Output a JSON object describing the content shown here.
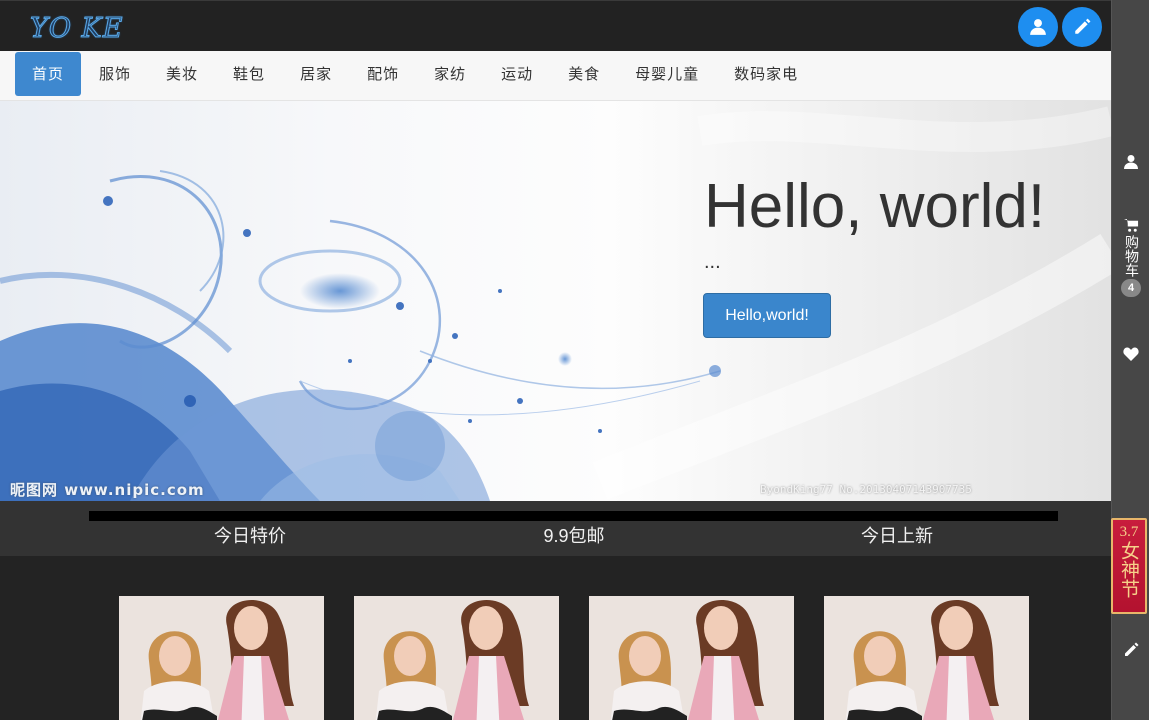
{
  "brand": {
    "logo_text": "YO KE"
  },
  "header": {
    "user_icon": "user-icon",
    "edit_icon": "pencil-icon"
  },
  "nav": {
    "items": [
      "首页",
      "服饰",
      "美妆",
      "鞋包",
      "居家",
      "配饰",
      "家纺",
      "运动",
      "美食",
      "母婴儿童",
      "数码家电"
    ],
    "active_index": 0
  },
  "hero": {
    "title": "Hello, world!",
    "text": "...",
    "button_label": "Hello,world!",
    "watermark_left": "昵图网 www.nipic.com",
    "watermark_right": "ByondKing77 No.20130407143907735"
  },
  "categories": [
    "今日特价",
    "9.9包邮",
    "今日上新"
  ],
  "products": [
    {
      "image": "two-models-photo"
    },
    {
      "image": "two-models-photo"
    },
    {
      "image": "two-models-photo"
    },
    {
      "image": "two-models-photo"
    }
  ],
  "sidebar": {
    "cart_label": "购物车",
    "cart_count": "4",
    "promo_number": "3.7",
    "promo_title": "女神节"
  },
  "colors": {
    "accent": "#3e88cf",
    "header_button": "#1e8ef0",
    "promo": "#c81d3d"
  }
}
